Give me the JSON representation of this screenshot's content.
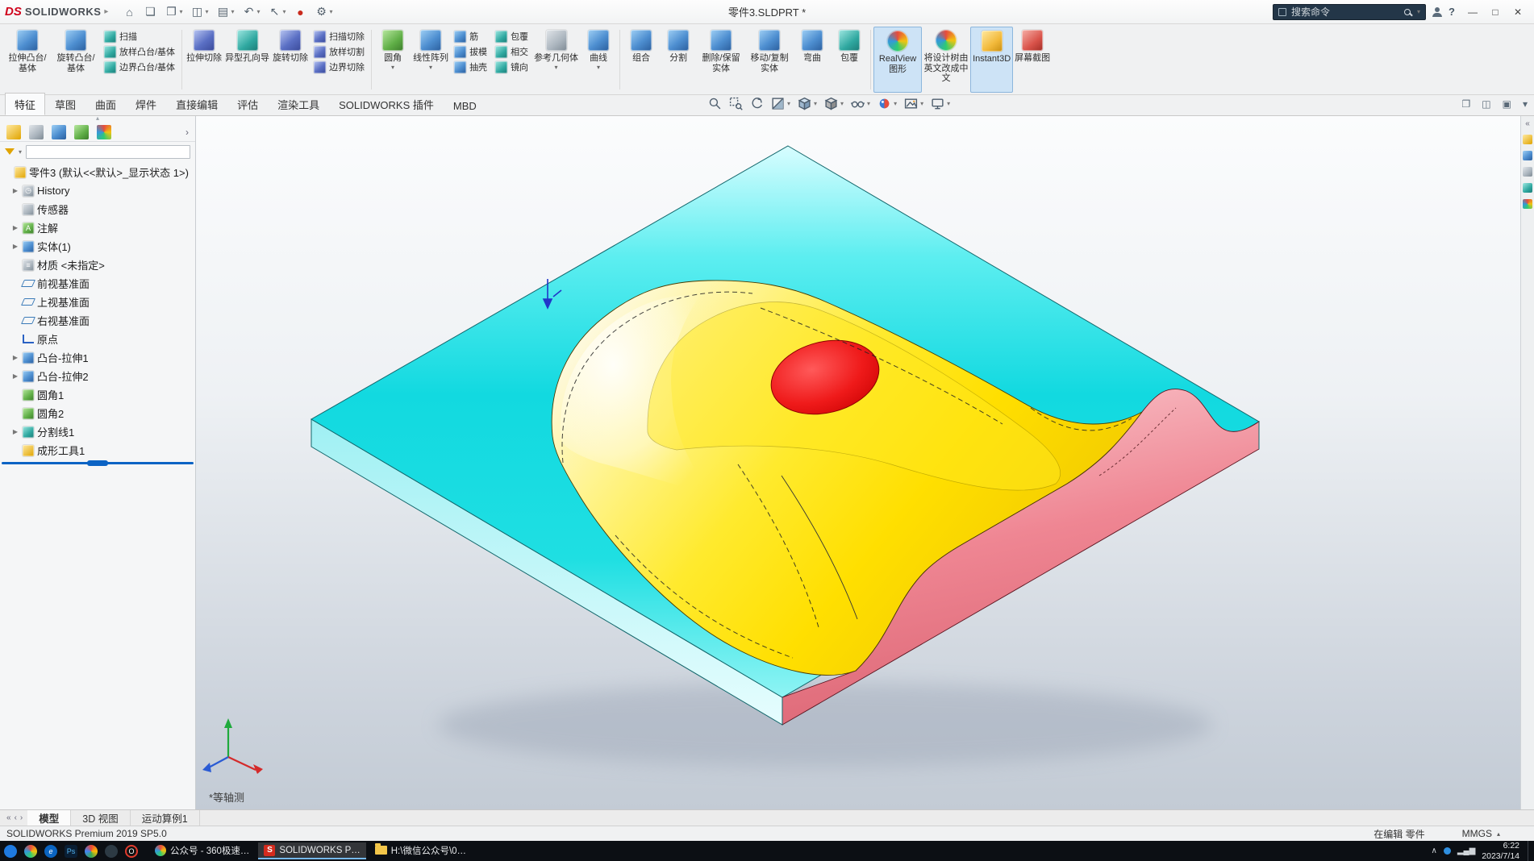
{
  "titlebar": {
    "logo_ds": "DS",
    "logo_text": "SOLIDWORKS",
    "document_title": "零件3.SLDPRT *",
    "search_placeholder": "搜索命令",
    "help_label": "?",
    "quick_access": [
      {
        "name": "home-icon",
        "caret": false
      },
      {
        "name": "new-document-icon",
        "caret": false
      },
      {
        "name": "open-icon",
        "caret": true
      },
      {
        "name": "save-icon",
        "caret": true
      },
      {
        "name": "print-icon",
        "caret": true
      },
      {
        "name": "undo-icon",
        "caret": true
      },
      {
        "name": "select-icon",
        "caret": true
      },
      {
        "name": "rebuild-icon",
        "caret": false
      },
      {
        "name": "options-icon",
        "caret": true
      }
    ]
  },
  "ribbon": {
    "items": [
      {
        "type": "large",
        "label": "拉伸凸台/基体",
        "icon": "extrude-boss-icon",
        "tint": "blue"
      },
      {
        "type": "large",
        "label": "旋转凸台/基体",
        "icon": "revolve-boss-icon",
        "tint": "blue"
      },
      {
        "type": "stack",
        "items": [
          {
            "label": "扫描",
            "icon": "sweep-icon",
            "tint": "teal"
          },
          {
            "label": "放样凸台/基体",
            "icon": "loft-icon",
            "tint": "teal"
          },
          {
            "label": "边界凸台/基体",
            "icon": "boundary-boss-icon",
            "tint": "teal"
          }
        ]
      },
      {
        "type": "sep"
      },
      {
        "type": "large",
        "label": "拉伸切除",
        "icon": "extruded-cut-icon",
        "tint": "indigo"
      },
      {
        "type": "large",
        "label": "异型孔向导",
        "icon": "hole-wizard-icon",
        "tint": "teal"
      },
      {
        "type": "large",
        "label": "旋转切除",
        "icon": "revolved-cut-icon",
        "tint": "indigo"
      },
      {
        "type": "stack",
        "items": [
          {
            "label": "扫描切除",
            "icon": "swept-cut-icon",
            "tint": "indigo"
          },
          {
            "label": "放样切割",
            "icon": "lofted-cut-icon",
            "tint": "indigo"
          },
          {
            "label": "边界切除",
            "icon": "boundary-cut-icon",
            "tint": "indigo"
          }
        ]
      },
      {
        "type": "sep"
      },
      {
        "type": "large",
        "label": "圆角",
        "icon": "fillet-icon",
        "tint": "green",
        "caret": true
      },
      {
        "type": "large",
        "label": "线性阵列",
        "icon": "linear-pattern-icon",
        "tint": "blue",
        "caret": true
      },
      {
        "type": "stack",
        "items": [
          {
            "label": "筋",
            "icon": "rib-icon",
            "tint": "blue"
          },
          {
            "label": "拔模",
            "icon": "draft-icon",
            "tint": "blue"
          },
          {
            "label": "抽壳",
            "icon": "shell-icon",
            "tint": "blue"
          }
        ]
      },
      {
        "type": "stack",
        "items": [
          {
            "label": "包覆",
            "icon": "wrap-icon",
            "tint": "teal"
          },
          {
            "label": "相交",
            "icon": "intersect-icon",
            "tint": "teal"
          },
          {
            "label": "镜向",
            "icon": "mirror-icon",
            "tint": "teal"
          }
        ]
      },
      {
        "type": "large",
        "label": "参考几何体",
        "icon": "reference-geometry-icon",
        "tint": "gray",
        "caret": true
      },
      {
        "type": "large",
        "label": "曲线",
        "icon": "curves-icon",
        "tint": "blue",
        "caret": true
      },
      {
        "type": "sep"
      },
      {
        "type": "large",
        "label": "组合",
        "icon": "combine-icon",
        "tint": "blue"
      },
      {
        "type": "large",
        "label": "分割",
        "icon": "split-icon",
        "tint": "blue"
      },
      {
        "type": "large",
        "label": "删除/保留实体",
        "icon": "delete-keep-body-icon",
        "tint": "blue"
      },
      {
        "type": "large",
        "label": "移动/复制实体",
        "icon": "move-copy-body-icon",
        "tint": "blue"
      },
      {
        "type": "large",
        "label": "弯曲",
        "icon": "flex-icon",
        "tint": "blue"
      },
      {
        "type": "large",
        "label": "包覆",
        "icon": "wrap-feature-icon",
        "tint": "teal"
      },
      {
        "type": "sep"
      },
      {
        "type": "large",
        "label": "RealView图形",
        "icon": "realview-graphics-icon",
        "tint": "multi",
        "active": true
      },
      {
        "type": "large",
        "label": "将设计树由英文改成中文",
        "icon": "translate-tree-icon",
        "tint": "multi"
      },
      {
        "type": "large",
        "label": "Instant3D",
        "icon": "instant3d-icon",
        "tint": "yellow",
        "active": true
      },
      {
        "type": "large",
        "label": "屏幕截图",
        "icon": "screen-capture-icon",
        "tint": "red"
      }
    ]
  },
  "command_tabs": {
    "tabs": [
      "特征",
      "草图",
      "曲面",
      "焊件",
      "直接编辑",
      "评估",
      "渲染工具",
      "SOLIDWORKS 插件",
      "MBD"
    ],
    "active": "特征"
  },
  "headsup": {
    "icons": [
      {
        "name": "zoom-fit-icon",
        "caret": false
      },
      {
        "name": "zoom-area-icon",
        "caret": false
      },
      {
        "name": "previous-view-icon",
        "caret": false
      },
      {
        "name": "section-view-icon",
        "caret": true
      },
      {
        "name": "view-orientation-icon",
        "caret": true
      },
      {
        "name": "display-style-icon",
        "caret": true
      },
      {
        "name": "hide-show-items-icon",
        "caret": true
      },
      {
        "name": "edit-appearance-icon",
        "caret": true
      },
      {
        "name": "apply-scene-icon",
        "caret": true
      },
      {
        "name": "view-settings-icon",
        "caret": true
      }
    ]
  },
  "feature_tree": {
    "root": "零件3 (默认<<默认>_显示状态 1>)",
    "items": [
      {
        "label": "History",
        "icon": "history-icon",
        "arrow": true
      },
      {
        "label": "传感器",
        "icon": "sensors-icon",
        "arrow": false
      },
      {
        "label": "注解",
        "icon": "annotations-icon",
        "arrow": true
      },
      {
        "label": "实体(1)",
        "icon": "solid-bodies-icon",
        "arrow": true
      },
      {
        "label": "材质 <未指定>",
        "icon": "material-icon",
        "arrow": false
      },
      {
        "label": "前视基准面",
        "icon": "plane-icon",
        "arrow": false
      },
      {
        "label": "上视基准面",
        "icon": "plane-icon",
        "arrow": false
      },
      {
        "label": "右视基准面",
        "icon": "plane-icon",
        "arrow": false
      },
      {
        "label": "原点",
        "icon": "origin-icon",
        "arrow": false
      },
      {
        "label": "凸台-拉伸1",
        "icon": "boss-extrude-icon",
        "arrow": true
      },
      {
        "label": "凸台-拉伸2",
        "icon": "boss-extrude-icon",
        "arrow": true
      },
      {
        "label": "圆角1",
        "icon": "fillet-feature-icon",
        "arrow": false
      },
      {
        "label": "圆角2",
        "icon": "fillet-feature-icon",
        "arrow": false
      },
      {
        "label": "分割线1",
        "icon": "split-line-icon",
        "arrow": true
      },
      {
        "label": "成形工具1",
        "icon": "forming-tool-icon",
        "arrow": false
      }
    ],
    "panel_tabs": [
      {
        "name": "featuremanager-tab-icon",
        "tint": "gold"
      },
      {
        "name": "propertymanager-tab-icon",
        "tint": "gray"
      },
      {
        "name": "configurationmanager-tab-icon",
        "tint": "blue"
      },
      {
        "name": "dimxpert-tab-icon",
        "tint": "green"
      },
      {
        "name": "displaymanager-tab-icon",
        "tint": "multi"
      }
    ]
  },
  "viewport": {
    "view_label": "*等轴测",
    "taskpane_icons": [
      {
        "name": "collapse-taskpane-icon"
      },
      {
        "name": "sw-resources-icon",
        "tint": "gold"
      },
      {
        "name": "design-library-icon",
        "tint": "blue"
      },
      {
        "name": "file-explorer-icon",
        "tint": "gray"
      },
      {
        "name": "view-palette-icon",
        "tint": "teal"
      },
      {
        "name": "appearances-icon",
        "tint": "multi"
      }
    ],
    "pane_controls": [
      {
        "name": "pane-previous-icon",
        "glyph": "❐"
      },
      {
        "name": "pane-split-icon",
        "glyph": "◫"
      },
      {
        "name": "pane-maximize-icon",
        "glyph": "▣"
      },
      {
        "name": "pane-close-icon",
        "glyph": "▾"
      }
    ]
  },
  "model_colors": {
    "plate_top": "#17dde3",
    "plate_side": "#aef6f8",
    "boss": "#ffe400",
    "boss_highlight": "#fdf7d0",
    "hole": "#e30613",
    "section_face": "#ef8693"
  },
  "bottom_tabs": {
    "tabs": [
      "模型",
      "3D 视图",
      "运动算例1"
    ],
    "active": "模型"
  },
  "statusbar": {
    "left": "SOLIDWORKS Premium 2019 SP5.0",
    "editing": "在编辑 零件",
    "units": "MMGS"
  },
  "taskbar": {
    "apps": [
      {
        "name": "app-blue-circle-icon",
        "style": "blue"
      },
      {
        "name": "app-multicolor-icon",
        "style": "multi"
      },
      {
        "name": "edge-browser-icon",
        "style": "edge",
        "glyph": "e"
      },
      {
        "name": "photoshop-icon",
        "style": "ps",
        "glyph": "Ps"
      },
      {
        "name": "chrome-browser-icon",
        "style": "chrome"
      },
      {
        "name": "app-dark-icon",
        "style": "dark"
      },
      {
        "name": "opera-browser-icon",
        "style": "opera",
        "glyph": "O"
      }
    ],
    "tasks": [
      {
        "label": "公众号 - 360极速…",
        "icon": "pinwheel-icon",
        "active": false
      },
      {
        "label": "SOLIDWORKS P…",
        "icon": "solidworks-app-icon",
        "active": true
      },
      {
        "label": "H:\\微信公众号\\0…",
        "icon": "folder-icon",
        "active": false
      }
    ],
    "tray_time": "6:22",
    "tray_date": "2023/7/14"
  }
}
